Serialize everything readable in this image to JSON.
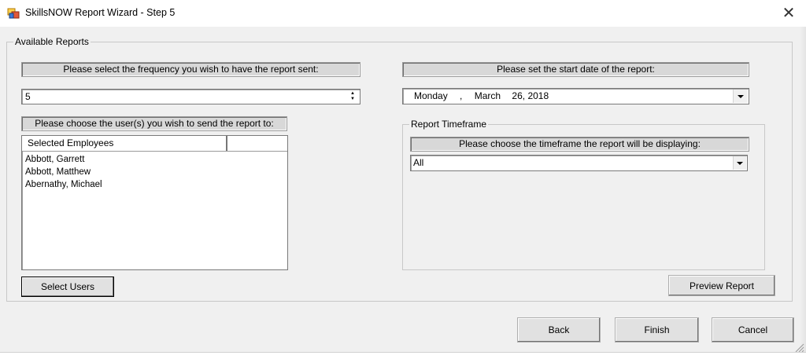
{
  "window": {
    "title": "SkillsNOW Report Wizard - Step 5",
    "close_glyph": "✕",
    "app_icon": "app-window-icon"
  },
  "available_reports": {
    "group_title": "Available Reports",
    "frequency": {
      "label": "Please select the frequency you wish to have the report sent:",
      "value": "5",
      "spin_up": "▲",
      "spin_down": "▼"
    },
    "users": {
      "label": "Please choose the user(s) you wish to send the report to:",
      "column_header": "Selected Employees",
      "items": [
        "Abbott, Garrett",
        "Abbott, Matthew",
        "Abernathy, Michael"
      ],
      "select_button": "Select Users"
    },
    "start_date": {
      "label": "Please set the start date of the report:",
      "day": "Monday",
      "sep": ",",
      "month": "March",
      "date": "26, 2018"
    },
    "timeframe": {
      "group_title": "Report Timeframe",
      "label": "Please choose the timeframe the report will be displaying:",
      "value": "All"
    },
    "preview_button": "Preview Report"
  },
  "footer": {
    "back": "Back",
    "finish": "Finish",
    "cancel": "Cancel"
  }
}
